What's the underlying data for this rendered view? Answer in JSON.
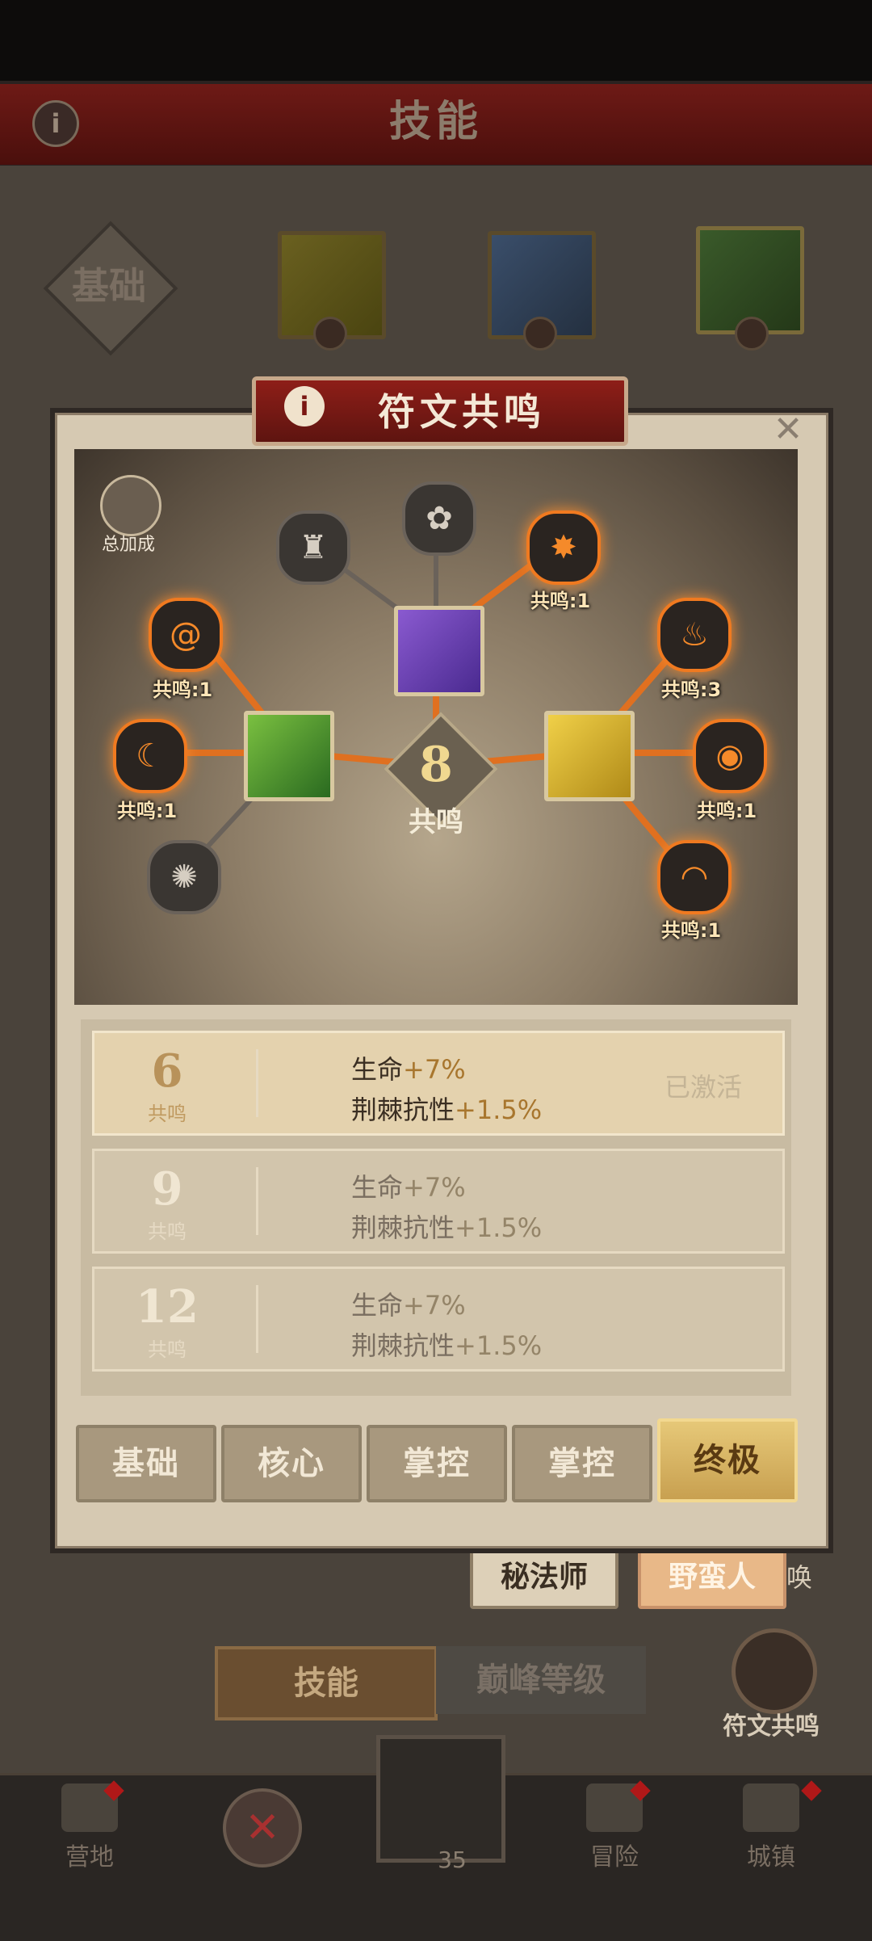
{
  "header": {
    "title": "技能",
    "info_icon": "info-icon"
  },
  "hero_tabs": {
    "basic_label": "基础"
  },
  "dialog": {
    "title": "符文共鸣",
    "close_icon": "close-icon",
    "total_bonus_label": "总加成",
    "center": {
      "value": "8",
      "label": "共鸣"
    },
    "node_counts": {
      "top_right": "共鸣:1",
      "left_upper": "共鸣:1",
      "left_middle": "共鸣:1",
      "right_upper": "共鸣:3",
      "right_middle": "共鸣:1",
      "right_lower": "共鸣:1"
    },
    "tiers": [
      {
        "threshold": "6",
        "unit": "共鸣",
        "stat1_name": "生命",
        "stat1_bonus": "+7%",
        "stat2_name": "荆棘抗性",
        "stat2_bonus": "+1.5%",
        "status": "已激活"
      },
      {
        "threshold": "9",
        "unit": "共鸣",
        "stat1_name": "生命",
        "stat1_bonus": "+7%",
        "stat2_name": "荆棘抗性",
        "stat2_bonus": "+1.5%",
        "status": ""
      },
      {
        "threshold": "12",
        "unit": "共鸣",
        "stat1_name": "生命",
        "stat1_bonus": "+7%",
        "stat2_name": "荆棘抗性",
        "stat2_bonus": "+1.5%",
        "status": ""
      }
    ],
    "tabs": [
      "基础",
      "核心",
      "掌控",
      "掌控",
      "终极"
    ],
    "selected_tab": "终极"
  },
  "background": {
    "class_buttons": [
      "秘法师",
      "野蛮人"
    ],
    "partial_text": "唤",
    "bottom_tabs": [
      "技能",
      "巅峰等级"
    ],
    "rune_label": "符文共鸣"
  },
  "nav": {
    "items": [
      "营地",
      "冒险",
      "城镇"
    ],
    "center_count": "35"
  },
  "colors": {
    "accent": "#f07a20",
    "banner": "#7a1a14",
    "selected_tab": "#d8b464"
  }
}
